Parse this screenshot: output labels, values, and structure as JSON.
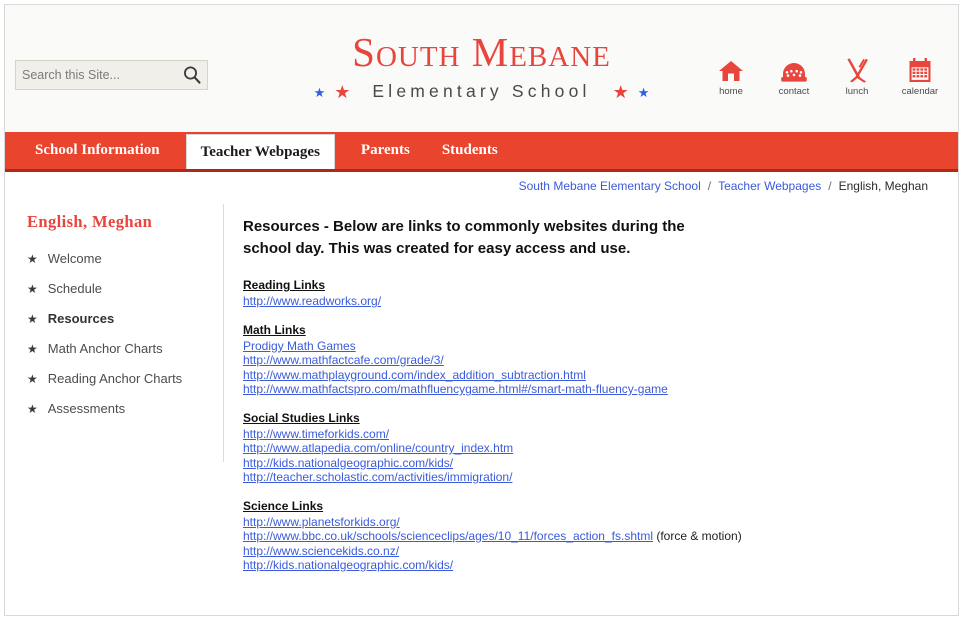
{
  "search": {
    "placeholder": "Search this Site...",
    "value": "",
    "icon": "search-icon"
  },
  "header": {
    "school_name": "South Mebane",
    "subtitle": "Elementary School",
    "decor_stars": [
      {
        "color": "#2f5fe0",
        "size": "small"
      },
      {
        "color": "#e8453c",
        "size": "medium"
      },
      {
        "color": "#e8453c",
        "size": "medium"
      },
      {
        "color": "#2f5fe0",
        "size": "small"
      }
    ],
    "brand_color": "#e8453c",
    "quicklinks": [
      {
        "label": "home",
        "icon": "home-icon"
      },
      {
        "label": "contact",
        "icon": "telephone-icon"
      },
      {
        "label": "lunch",
        "icon": "fork-knife-icon"
      },
      {
        "label": "calendar",
        "icon": "calendar-icon"
      }
    ]
  },
  "nav": {
    "bar_color": "#e8442e",
    "items": [
      {
        "label": "School Information",
        "active": false
      },
      {
        "label": "Teacher Webpages",
        "active": true
      },
      {
        "label": "Parents",
        "active": false
      },
      {
        "label": "Students",
        "active": false
      }
    ]
  },
  "breadcrumb": {
    "sep": "/",
    "items": [
      {
        "label": "South Mebane Elementary School",
        "current": false
      },
      {
        "label": "Teacher Webpages",
        "current": false
      },
      {
        "label": "English, Meghan",
        "current": true
      }
    ]
  },
  "sidebar": {
    "title": "English, Meghan",
    "bullet": "★",
    "items": [
      {
        "label": "Welcome",
        "active": false
      },
      {
        "label": "Schedule",
        "active": false
      },
      {
        "label": "Resources",
        "active": true
      },
      {
        "label": "Math Anchor Charts",
        "active": false
      },
      {
        "label": "Reading Anchor Charts",
        "active": false
      },
      {
        "label": "Assessments",
        "active": false
      }
    ]
  },
  "content": {
    "heading": "Resources - Below are links to commonly websites during the school day.  This was created for easy access and use.",
    "groups": [
      {
        "title": "Reading Links",
        "links": [
          {
            "text": "http://www.readworks.org/",
            "note": ""
          }
        ]
      },
      {
        "title": "Math Links",
        "links": [
          {
            "text": "Prodigy Math Games",
            "note": ""
          },
          {
            "text": "http://www.mathfactcafe.com/grade/3/",
            "note": ""
          },
          {
            "text": "http://www.mathplayground.com/index_addition_subtraction.html",
            "note": ""
          },
          {
            "text": "http://www.mathfactspro.com/mathfluencygame.html#/smart-math-fluency-game",
            "note": ""
          }
        ]
      },
      {
        "title": "Social Studies Links",
        "links": [
          {
            "text": "http://www.timeforkids.com/",
            "note": ""
          },
          {
            "text": "http://www.atlapedia.com/online/country_index.htm",
            "note": ""
          },
          {
            "text": "http://kids.nationalgeographic.com/kids/",
            "note": ""
          },
          {
            "text": "http://teacher.scholastic.com/activities/immigration/",
            "note": ""
          }
        ]
      },
      {
        "title": "Science Links",
        "links": [
          {
            "text": "http://www.planetsforkids.org/",
            "note": ""
          },
          {
            "text": "http://www.bbc.co.uk/schools/scienceclips/ages/10_11/forces_action_fs.shtml",
            "note": " (force & motion)"
          },
          {
            "text": "http://www.sciencekids.co.nz/",
            "note": ""
          },
          {
            "text": "http://kids.nationalgeographic.com/kids/",
            "note": ""
          }
        ]
      }
    ]
  }
}
